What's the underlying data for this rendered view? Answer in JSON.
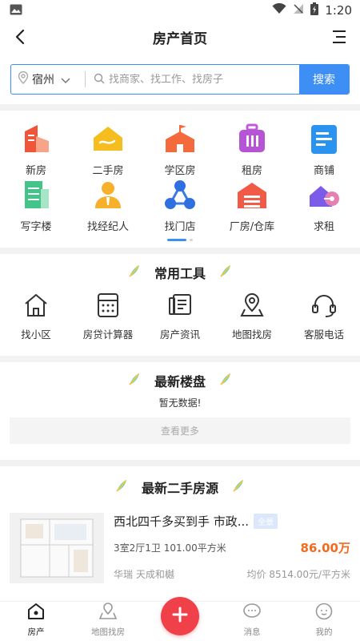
{
  "status_bar": {
    "time": "1:20"
  },
  "header": {
    "title": "房产首页"
  },
  "search": {
    "city": "宿州",
    "placeholder": "找商家、找工作、找房子",
    "button_label": "搜索"
  },
  "categories": [
    {
      "label": "新房",
      "icon": "building-icon"
    },
    {
      "label": "二手房",
      "icon": "house-hand-icon"
    },
    {
      "label": "学区房",
      "icon": "school-icon"
    },
    {
      "label": "租房",
      "icon": "suitcase-icon"
    },
    {
      "label": "商铺",
      "icon": "document-icon"
    },
    {
      "label": "写字楼",
      "icon": "office-building-icon"
    },
    {
      "label": "找经纪人",
      "icon": "agent-icon"
    },
    {
      "label": "找门店",
      "icon": "store-network-icon"
    },
    {
      "label": "厂房/仓库",
      "icon": "warehouse-icon"
    },
    {
      "label": "求租",
      "icon": "house-key-icon"
    }
  ],
  "tools_section": {
    "title": "常用工具",
    "items": [
      {
        "label": "找小区",
        "icon": "home-outline-icon"
      },
      {
        "label": "房贷计算器",
        "icon": "calculator-icon"
      },
      {
        "label": "房产资讯",
        "icon": "news-icon"
      },
      {
        "label": "地图找房",
        "icon": "map-pin-icon"
      },
      {
        "label": "客服电话",
        "icon": "headset-icon"
      }
    ]
  },
  "new_listings_section": {
    "title": "最新楼盘",
    "empty_text": "暂无数据!",
    "more_label": "查看更多"
  },
  "secondhand_section": {
    "title": "最新二手房源",
    "listings": [
      {
        "title": "西北四千多买到手 市政...",
        "tag": "全景",
        "spec": "3室2厅1卫   101.00平方米",
        "price": "86.00万",
        "community": "华瑞 天成和樾",
        "unit_price": "均价 8514.00元/平方米"
      }
    ]
  },
  "tabbar": [
    {
      "label": "房产",
      "icon": "home-tab-icon",
      "active": true
    },
    {
      "label": "地图找房",
      "icon": "map-tab-icon",
      "active": false
    },
    {
      "label": "",
      "icon": "plus-icon",
      "active": false
    },
    {
      "label": "消息",
      "icon": "message-tab-icon",
      "active": false
    },
    {
      "label": "我的",
      "icon": "profile-tab-icon",
      "active": false
    }
  ],
  "colors": {
    "accent": "#3d8ff5",
    "price": "#f36a1e",
    "fab": "#f0414a"
  }
}
